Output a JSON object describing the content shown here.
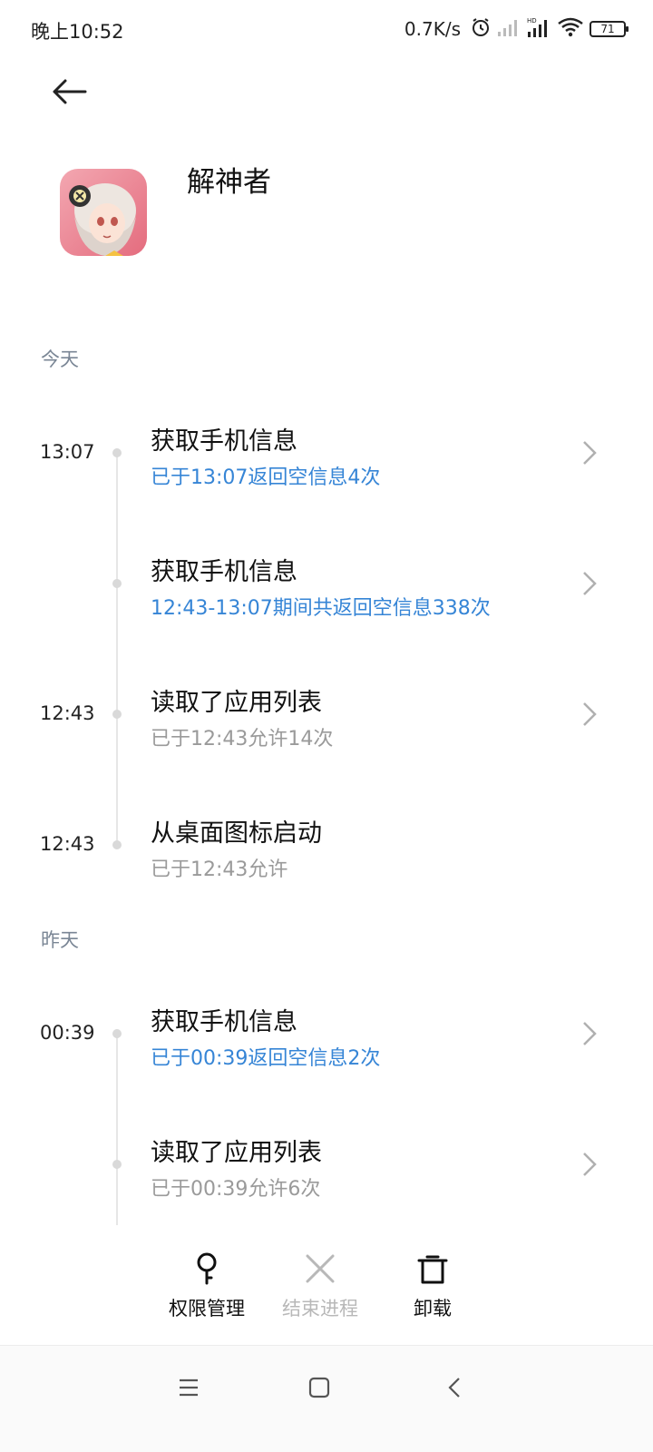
{
  "status_bar": {
    "time": "晚上10:52",
    "net_speed": "0.7K/s",
    "battery": "71"
  },
  "app": {
    "name": "解神者"
  },
  "sections": [
    {
      "label": "今天",
      "events": [
        {
          "time": "13:07",
          "title": "获取手机信息",
          "subtitle": "已于13:07返回空信息4次",
          "subtitle_style": "blue",
          "has_chevron": true
        },
        {
          "time": "",
          "title": "获取手机信息",
          "subtitle": "12:43-13:07期间共返回空信息338次",
          "subtitle_style": "blue",
          "has_chevron": true
        },
        {
          "time": "12:43",
          "title": "读取了应用列表",
          "subtitle": "已于12:43允许14次",
          "subtitle_style": "gray",
          "has_chevron": true
        },
        {
          "time": "12:43",
          "title": "从桌面图标启动",
          "subtitle": "已于12:43允许",
          "subtitle_style": "gray",
          "has_chevron": false
        }
      ]
    },
    {
      "label": "昨天",
      "events": [
        {
          "time": "00:39",
          "title": "获取手机信息",
          "subtitle": "已于00:39返回空信息2次",
          "subtitle_style": "blue",
          "has_chevron": true
        },
        {
          "time": "",
          "title": "读取了应用列表",
          "subtitle": "已于00:39允许6次",
          "subtitle_style": "gray",
          "has_chevron": true
        }
      ]
    }
  ],
  "actions": {
    "permissions": {
      "label": "权限管理",
      "icon": "key-icon",
      "enabled": true
    },
    "end_process": {
      "label": "结束进程",
      "icon": "close-icon",
      "enabled": false
    },
    "uninstall": {
      "label": "卸载",
      "icon": "trash-icon",
      "enabled": true
    }
  },
  "colors": {
    "accent_blue": "#3685d6",
    "secondary_gray": "#9a9a9a",
    "section_label": "#7a8695",
    "disabled": "#b8b8b8"
  }
}
